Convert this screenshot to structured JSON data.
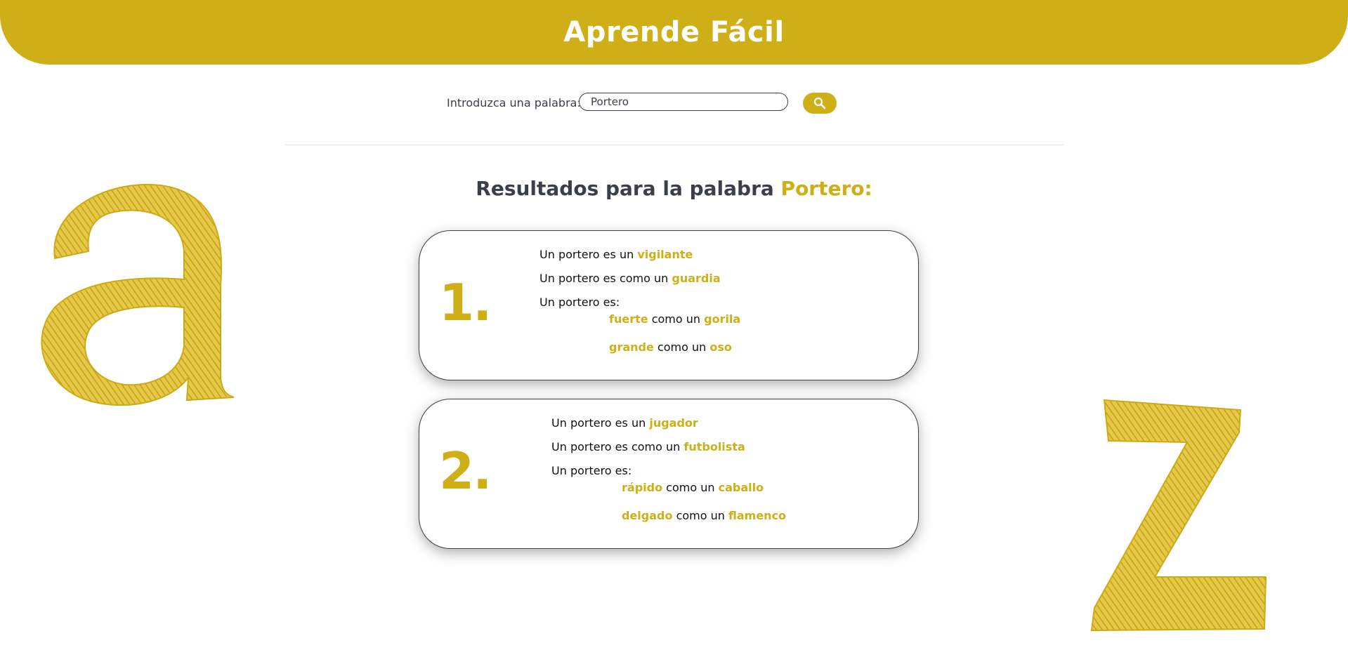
{
  "header": {
    "title": "Aprende Fácil"
  },
  "search": {
    "label": "Introduzca una palabra:",
    "value": "Portero",
    "button_icon": "search-icon"
  },
  "results": {
    "title_prefix": "Resultados para la palabra",
    "title_word": "Portero:",
    "cards": [
      {
        "number": "1.",
        "line1": {
          "text": "Un portero es un",
          "word": "vigilante"
        },
        "line2": {
          "text": "Un portero es como un",
          "word": "guardia"
        },
        "line3": {
          "text": "Un portero es:"
        },
        "similes": [
          {
            "adj": "fuerte",
            "mid": "como un",
            "noun": "gorila"
          },
          {
            "adj": "grande",
            "mid": "como un",
            "noun": "oso"
          }
        ]
      },
      {
        "number": "2.",
        "line1": {
          "text": "Un portero es un",
          "word": "jugador"
        },
        "line2": {
          "text": "Un portero es como un",
          "word": "futbolista"
        },
        "line3": {
          "text": "Un portero es:"
        },
        "similes": [
          {
            "adj": "rápido",
            "mid": "como un",
            "noun": "caballo"
          },
          {
            "adj": "delgado",
            "mid": "como un",
            "noun": "flamenco"
          }
        ]
      }
    ]
  },
  "decorations": {
    "left_letter": "a",
    "right_letter": "z"
  },
  "colors": {
    "accent": "#ceaf17",
    "text": "#3a3f4a",
    "background": "#ffffff"
  }
}
